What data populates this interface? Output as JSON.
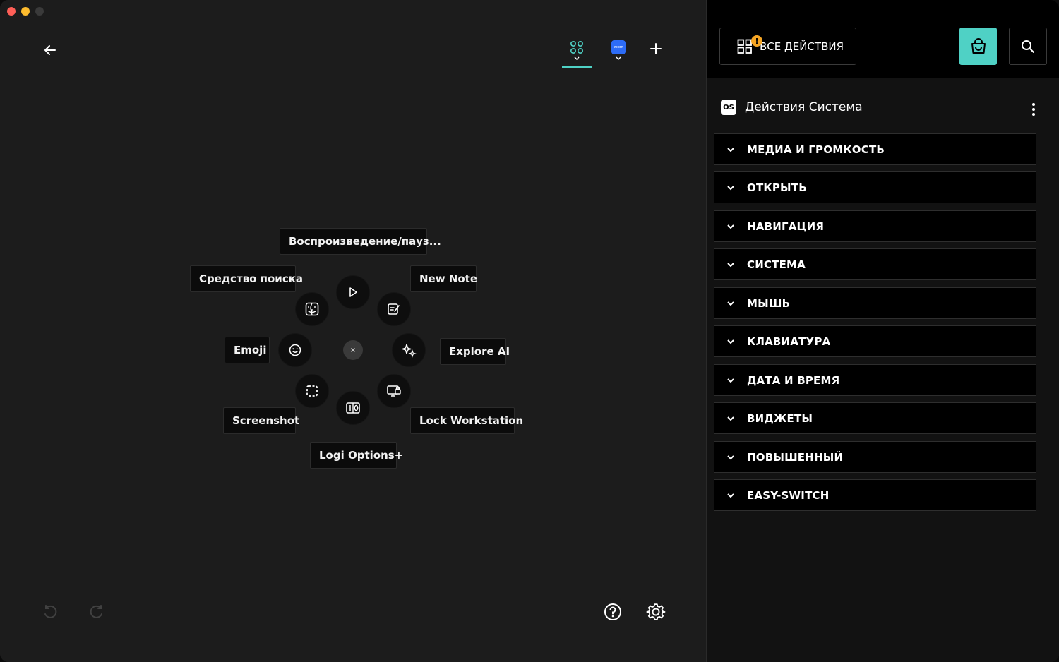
{
  "window": {
    "traffic_lights": [
      "#ff5f57",
      "#febc2e",
      "#3a3a3a"
    ]
  },
  "toolbar": {
    "back_icon": "arrow-left-icon",
    "tabs": [
      {
        "icon": "apps-grid-icon",
        "selected": true,
        "accent": "#4fd1c5"
      },
      {
        "icon": "zoom-app-icon",
        "selected": false,
        "accent": "#2d6cf6",
        "app_text": "zoom"
      }
    ],
    "add_icon": "plus-icon"
  },
  "radial_menu": {
    "center_label": "×",
    "items": [
      {
        "label": "Воспроизведение/пауз...",
        "icon": "play-icon"
      },
      {
        "label": "New Note",
        "icon": "note-edit-icon"
      },
      {
        "label": "Explore AI",
        "icon": "sparkles-ai-icon"
      },
      {
        "label": "Lock Workstation",
        "icon": "lock-screen-icon"
      },
      {
        "label": "Logi Options+",
        "icon": "logi-options-icon"
      },
      {
        "label": "Screenshot",
        "icon": "screenshot-select-icon"
      },
      {
        "label": "Emoji",
        "icon": "emoji-smile-icon"
      },
      {
        "label": "Средство поиска",
        "icon": "finder-icon"
      }
    ]
  },
  "bottom_left": {
    "undo_icon": "undo-icon",
    "redo_icon": "redo-icon"
  },
  "bottom_right": {
    "help_icon": "help-icon",
    "settings_icon": "gear-icon"
  },
  "right_panel": {
    "all_actions_label": "ВСЕ ДЕЙСТВИЯ",
    "badge": "!",
    "shop_icon": "shopping-bag-icon",
    "search_icon": "search-icon",
    "section": {
      "os_badge": "OS",
      "title": "Действия Система"
    },
    "categories": [
      "МЕДИА И ГРОМКОСТЬ",
      "ОТКРЫТЬ",
      "НАВИГАЦИЯ",
      "СИСТЕМА",
      "МЫШЬ",
      "КЛАВИАТУРА",
      "ДАТА И ВРЕМЯ",
      "ВИДЖЕТЫ",
      "ПОВЫШЕННЫЙ",
      "EASY-SWITCH"
    ]
  }
}
